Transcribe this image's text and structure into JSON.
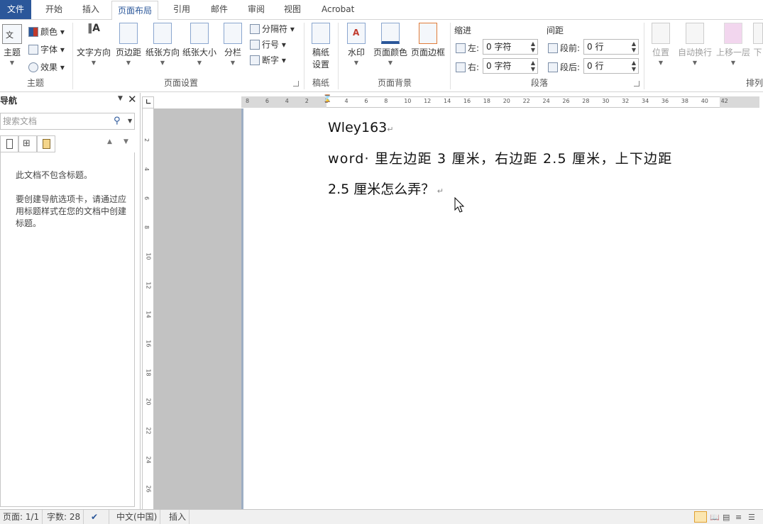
{
  "tabs": {
    "file": "文件",
    "home": "开始",
    "insert": "插入",
    "layout": "页面布局",
    "references": "引用",
    "mailings": "邮件",
    "review": "审阅",
    "view": "视图",
    "acrobat": "Acrobat"
  },
  "ribbon": {
    "themes": {
      "theme": "主题",
      "colors": "颜色",
      "fonts": "字体",
      "effects": "效果",
      "group": "主题"
    },
    "page_setup": {
      "text_direction": "文字方向",
      "margins": "页边距",
      "orientation": "纸张方向",
      "size": "纸张大小",
      "columns": "分栏",
      "breaks": "分隔符",
      "line_numbers": "行号",
      "hyphenation": "断字",
      "group": "页面设置"
    },
    "manuscript": {
      "manuscript_setup_1": "稿纸",
      "manuscript_setup_2": "设置",
      "group": "稿纸"
    },
    "page_background": {
      "watermark": "水印",
      "page_color": "页面颜色",
      "page_borders": "页面边框",
      "group": "页面背景"
    },
    "paragraph": {
      "indent": "缩进",
      "spacing": "间距",
      "left": "左:",
      "right": "右:",
      "before": "段前:",
      "after": "段后:",
      "left_value": "0 字符",
      "right_value": "0 字符",
      "before_value": "0 行",
      "after_value": "0 行",
      "group": "段落"
    },
    "arrange": {
      "position": "位置",
      "wrap_text": "自动换行",
      "bring_forward": "上移一层",
      "send_backward": "下",
      "group": "排列"
    }
  },
  "nav": {
    "title": "导航",
    "search_placeholder": "搜索文档",
    "msg1": "此文档不包含标题。",
    "msg2": "要创建导航选项卡，请通过应用标题样式在您的文档中创建标题。"
  },
  "hruler_labels": [
    "8",
    "6",
    "4",
    "2",
    "2",
    "4",
    "6",
    "8",
    "10",
    "12",
    "14",
    "16",
    "18",
    "20",
    "22",
    "24",
    "26",
    "28",
    "30",
    "32",
    "34",
    "36",
    "38",
    "40",
    "42"
  ],
  "vruler_labels": [
    "2",
    "4",
    "6",
    "8",
    "10",
    "12",
    "14",
    "16",
    "18",
    "20",
    "22",
    "24",
    "26"
  ],
  "document": {
    "line1": "Wley163",
    "line2": "word· 里左边距 3 厘米，右边距 2.5 厘米，上下边距",
    "line3": "2.5 厘米怎么弄？"
  },
  "status": {
    "page": "页面: 1/1",
    "words": "字数: 28",
    "language": "中文(中国)",
    "mode": "插入"
  }
}
